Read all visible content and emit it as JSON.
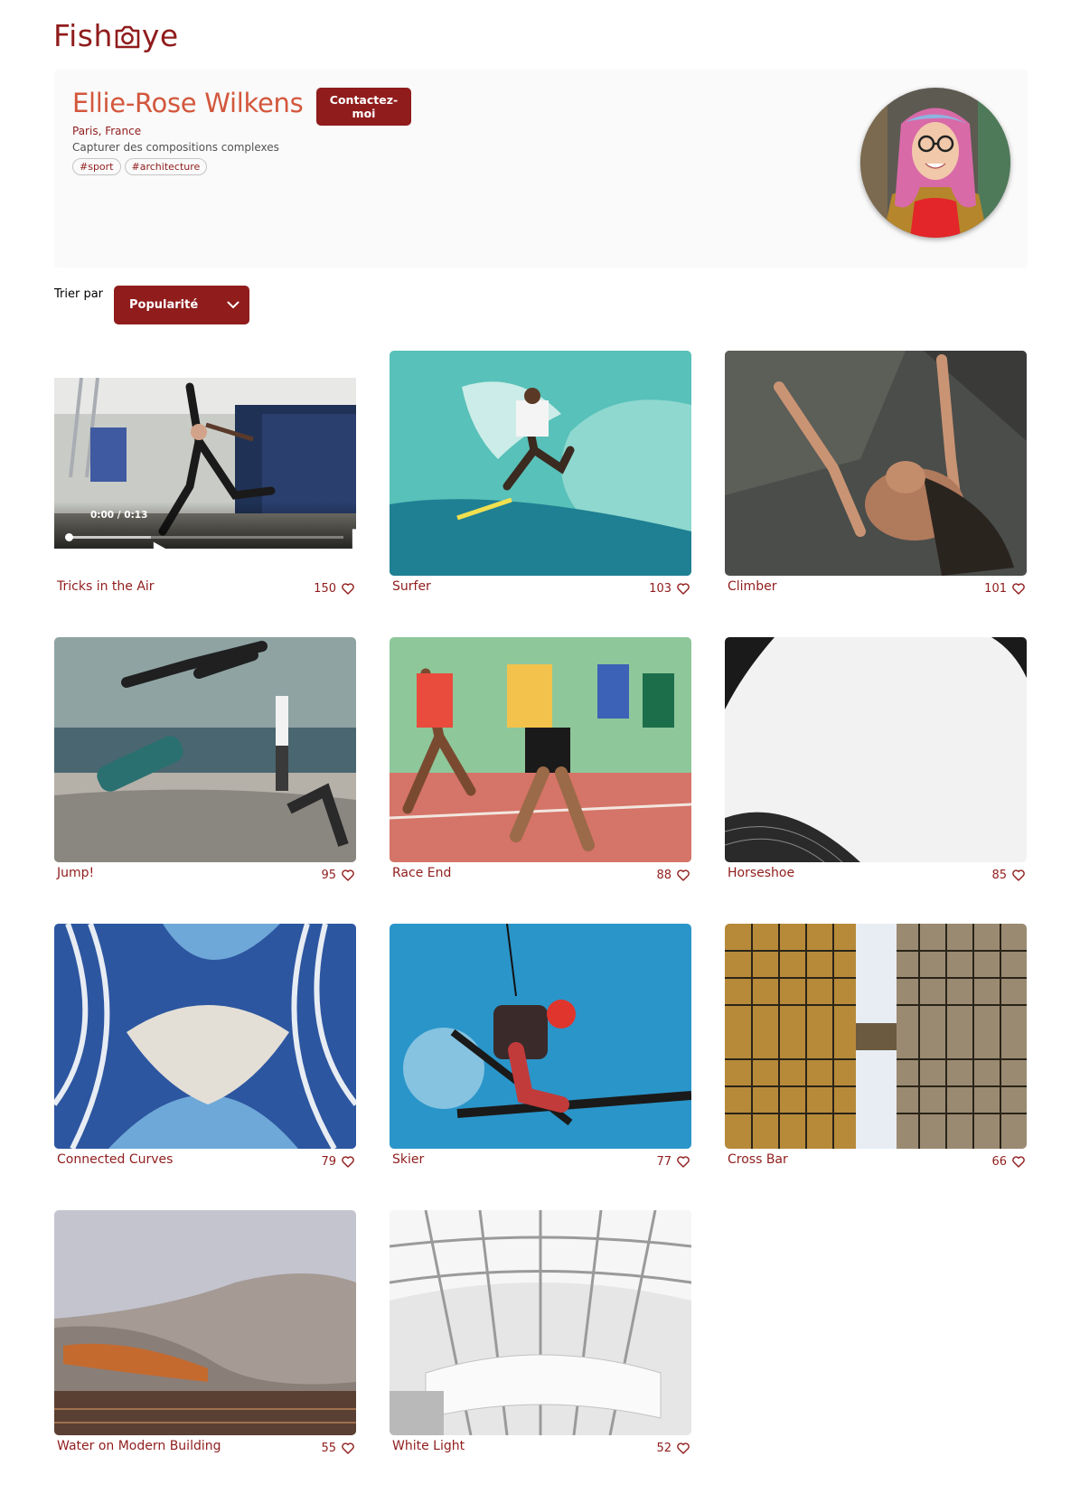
{
  "brand": {
    "logo_text_left": "Fish",
    "logo_text_right": "ye",
    "color": "#901c1c"
  },
  "photographer": {
    "name": "Ellie-Rose Wilkens",
    "location": "Paris, France",
    "tagline": "Capturer des compositions complexes",
    "tags": [
      "#sport",
      "#architecture"
    ],
    "contact_label": "Contactez-moi"
  },
  "sort": {
    "label": "Trier par",
    "selected": "Popularité"
  },
  "video": {
    "time": "0:00 / 0:13",
    "progress": 0.0
  },
  "media": [
    {
      "title": "Tricks in the Air",
      "likes": "150",
      "kind": "video"
    },
    {
      "title": "Surfer",
      "likes": "103",
      "kind": "image"
    },
    {
      "title": "Climber",
      "likes": "101",
      "kind": "image"
    },
    {
      "title": "Jump!",
      "likes": "95",
      "kind": "image"
    },
    {
      "title": "Race End",
      "likes": "88",
      "kind": "image"
    },
    {
      "title": "Horseshoe",
      "likes": "85",
      "kind": "image"
    },
    {
      "title": "Connected Curves",
      "likes": "79",
      "kind": "image"
    },
    {
      "title": "Skier",
      "likes": "77",
      "kind": "image"
    },
    {
      "title": "Cross Bar",
      "likes": "66",
      "kind": "image"
    },
    {
      "title": "Water on Modern Building",
      "likes": "55",
      "kind": "image"
    },
    {
      "title": "White Light",
      "likes": "52",
      "kind": "image"
    }
  ],
  "colors": {
    "accent": "#901c1c",
    "name": "#d3573c",
    "panel": "#fafafa"
  }
}
